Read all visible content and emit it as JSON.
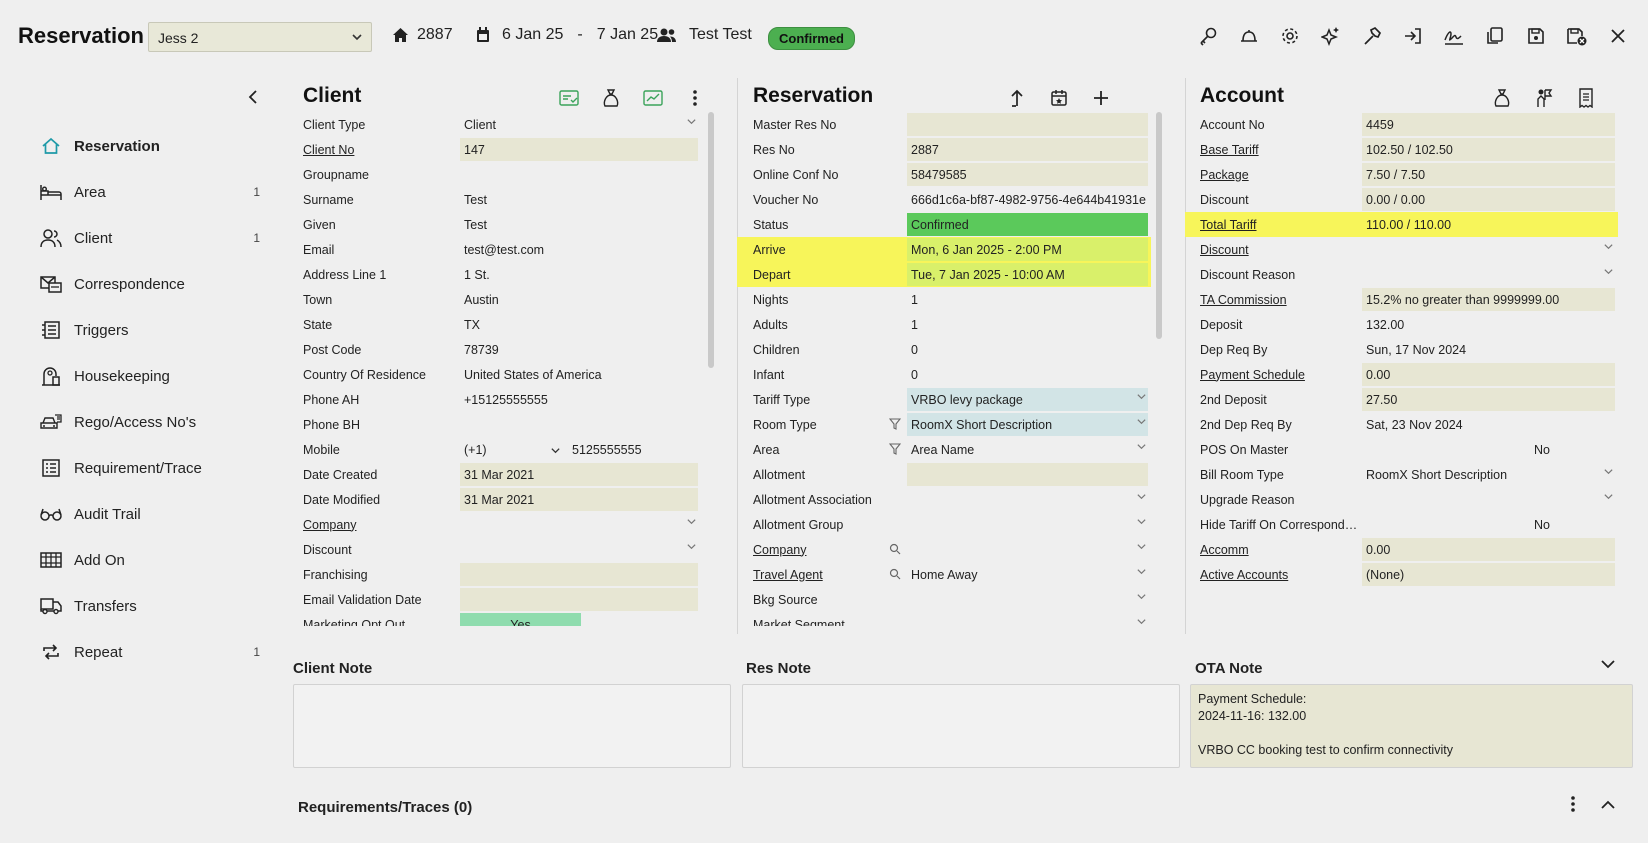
{
  "header": {
    "title": "Reservation",
    "property": "Jess 2",
    "room_number": "2887",
    "date_from": "6 Jan 25",
    "date_sep": "-",
    "date_to": "7 Jan 25",
    "guest": "Test Test",
    "status": "Confirmed",
    "status_color": "#4caf50"
  },
  "toolbar_icons": [
    "key-icon",
    "bell-icon",
    "gear-icon",
    "sparkle-icon",
    "hammer-icon",
    "login-icon",
    "signature-icon",
    "copy-icon",
    "save-icon",
    "save-close-icon",
    "close-icon"
  ],
  "sidebar": {
    "items": [
      {
        "label": "Reservation",
        "count": "",
        "icon": "home-icon"
      },
      {
        "label": "Area",
        "count": "1",
        "icon": "bed-icon"
      },
      {
        "label": "Client",
        "count": "1",
        "icon": "users-icon"
      },
      {
        "label": "Correspondence",
        "count": "",
        "icon": "mail-icon"
      },
      {
        "label": "Triggers",
        "count": "",
        "icon": "list-icon"
      },
      {
        "label": "Housekeeping",
        "count": "",
        "icon": "housekeeping-icon"
      },
      {
        "label": "Rego/Access No's",
        "count": "",
        "icon": "car-icon"
      },
      {
        "label": "Requirement/Trace",
        "count": "",
        "icon": "checklist-icon"
      },
      {
        "label": "Audit Trail",
        "count": "",
        "icon": "glasses-icon"
      },
      {
        "label": "Add On",
        "count": "",
        "icon": "grid-icon"
      },
      {
        "label": "Transfers",
        "count": "",
        "icon": "bus-icon"
      },
      {
        "label": "Repeat",
        "count": "1",
        "icon": "repeat-icon"
      }
    ]
  },
  "client": {
    "title": "Client",
    "rows": [
      {
        "label": "Client Type",
        "value": "Client"
      },
      {
        "label": "Client No",
        "value": "147"
      },
      {
        "label": "Groupname",
        "value": ""
      },
      {
        "label": "Surname",
        "value": "Test"
      },
      {
        "label": "Given",
        "value": "Test"
      },
      {
        "label": "Email",
        "value": "test@test.com"
      },
      {
        "label": "Address Line 1",
        "value": "1 St."
      },
      {
        "label": "Town",
        "value": "Austin"
      },
      {
        "label": "State",
        "value": "TX"
      },
      {
        "label": "Post Code",
        "value": "78739"
      },
      {
        "label": "Country Of Residence",
        "value": "United States of America"
      },
      {
        "label": "Phone AH",
        "value": "+15125555555"
      },
      {
        "label": "Phone BH",
        "value": ""
      },
      {
        "label": "Mobile",
        "value": "5125555555",
        "prefix": "(+1)"
      },
      {
        "label": "Date Created",
        "value": "31 Mar 2021"
      },
      {
        "label": "Date Modified",
        "value": "31 Mar 2021"
      },
      {
        "label": "Company",
        "value": ""
      },
      {
        "label": "Discount",
        "value": ""
      },
      {
        "label": "Franchising",
        "value": ""
      },
      {
        "label": "Email Validation Date",
        "value": ""
      },
      {
        "label": "Marketing Opt Out",
        "value": "Yes"
      }
    ]
  },
  "reservation": {
    "title": "Reservation",
    "rows": [
      {
        "label": "Master Res No",
        "value": ""
      },
      {
        "label": "Res No",
        "value": "2887"
      },
      {
        "label": "Online Conf No",
        "value": "58479585"
      },
      {
        "label": "Voucher No",
        "value": "666d1c6a-bf87-4982-9756-4e644b41931e"
      },
      {
        "label": "Status",
        "value": "Confirmed"
      },
      {
        "label": "Arrive",
        "value": "Mon, 6 Jan 2025 - 2:00 PM"
      },
      {
        "label": "Depart",
        "value": "Tue, 7 Jan 2025 - 10:00 AM"
      },
      {
        "label": "Nights",
        "value": "1"
      },
      {
        "label": "Adults",
        "value": "1"
      },
      {
        "label": "Children",
        "value": "0"
      },
      {
        "label": "Infant",
        "value": "0"
      },
      {
        "label": "Tariff Type",
        "value": "VRBO levy package"
      },
      {
        "label": "Room Type",
        "value": "RoomX Short Description"
      },
      {
        "label": "Area",
        "value": "Area Name"
      },
      {
        "label": "Allotment",
        "value": ""
      },
      {
        "label": "Allotment Association",
        "value": ""
      },
      {
        "label": "Allotment Group",
        "value": ""
      },
      {
        "label": "Company",
        "value": ""
      },
      {
        "label": "Travel Agent",
        "value": "Home Away"
      },
      {
        "label": "Bkg Source",
        "value": ""
      },
      {
        "label": "Market Segment",
        "value": ""
      }
    ]
  },
  "account": {
    "title": "Account",
    "rows": [
      {
        "label": "Account No",
        "value": "4459"
      },
      {
        "label": "Base Tariff",
        "value": "102.50 / 102.50"
      },
      {
        "label": "Package",
        "value": "7.50 / 7.50"
      },
      {
        "label": "Discount",
        "value": "0.00 / 0.00"
      },
      {
        "label": "Total Tariff",
        "value": "110.00 / 110.00"
      },
      {
        "label": "Discount",
        "value": ""
      },
      {
        "label": "Discount Reason",
        "value": ""
      },
      {
        "label": "TA Commission",
        "value": "15.2% no greater than 9999999.00"
      },
      {
        "label": "Deposit",
        "value": "132.00"
      },
      {
        "label": "Dep Req By",
        "value": "Sun, 17 Nov 2024"
      },
      {
        "label": "Payment Schedule",
        "value": "0.00"
      },
      {
        "label": "2nd Deposit",
        "value": "27.50"
      },
      {
        "label": "2nd Dep Req By",
        "value": "Sat, 23 Nov 2024"
      },
      {
        "label": "POS On Master",
        "value": "No"
      },
      {
        "label": "Bill Room Type",
        "value": "RoomX Short Description"
      },
      {
        "label": "Upgrade Reason",
        "value": ""
      },
      {
        "label": "Hide Tariff On Correspondence",
        "value": "No"
      },
      {
        "label": "Accomm",
        "value": "0.00"
      },
      {
        "label": "Active Accounts",
        "value": "(None)"
      }
    ]
  },
  "notes": {
    "client_note_label": "Client Note",
    "res_note_label": "Res Note",
    "ota_note_label": "OTA Note",
    "ota_note_text": "Payment Schedule:\n2024-11-16: 132.00\n\nVRBO CC booking test to confirm connectivity"
  },
  "requirements_label": "Requirements/Traces (0)",
  "colors": {
    "field_fill": "#e7e6d3",
    "highlight_yellow": "#f7f55a",
    "status_green": "#5bc95b",
    "tariff_blue": "#d2e4e6"
  }
}
